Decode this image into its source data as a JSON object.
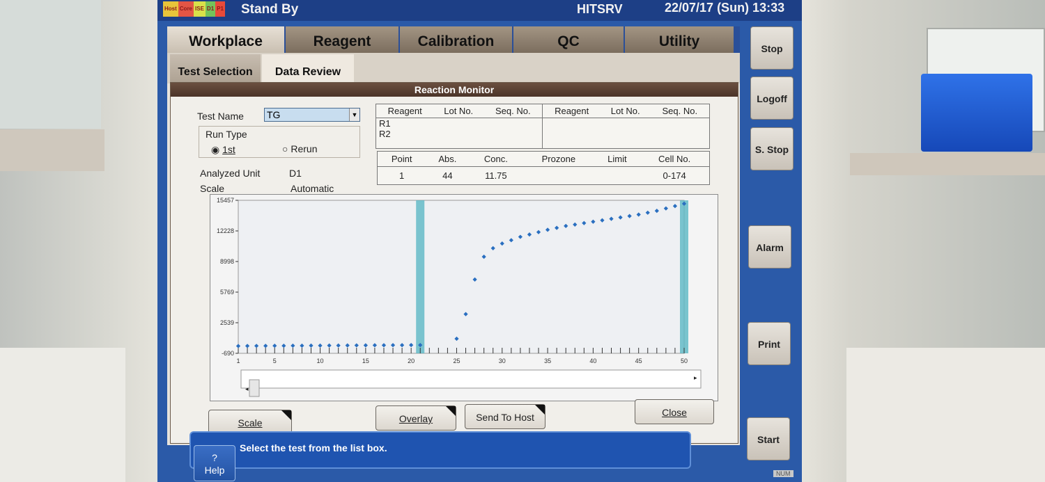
{
  "statusbar": {
    "blocks": [
      {
        "label": "Host",
        "color": "#e8c43a"
      },
      {
        "label": "Core",
        "color": "#e25545"
      },
      {
        "label": "ISE",
        "color": "#d9e04a"
      },
      {
        "label": "D1",
        "color": "#74c35a"
      },
      {
        "label": "P1",
        "color": "#e84a3a"
      }
    ],
    "status": "Stand By",
    "server": "HITSRV",
    "datetime": "22/07/17 (Sun) 13:33"
  },
  "side_buttons": {
    "stop": "Stop",
    "logoff": "Logoff",
    "s_stop": "S. Stop",
    "alarm": "Alarm",
    "print": "Print",
    "start": "Start"
  },
  "tabs": [
    "Workplace",
    "Reagent",
    "Calibration",
    "QC",
    "Utility"
  ],
  "subtabs": [
    "Test Selection",
    "Data Review"
  ],
  "dialog": {
    "title": "Reaction Monitor",
    "test_name_label": "Test Name",
    "test_name_value": "TG",
    "run_type_label": "Run Type",
    "run_type_options": [
      "1st",
      "Rerun"
    ],
    "run_type_selected": "1st",
    "analyzed_unit_label": "Analyzed Unit",
    "analyzed_unit_value": "D1",
    "scale_label": "Scale",
    "scale_value": "Automatic",
    "reagent_table": {
      "headers": [
        "Reagent",
        "Lot No.",
        "Seq. No.",
        "Reagent",
        "Lot No.",
        "Seq. No."
      ],
      "rows": [
        "R1",
        "R2"
      ]
    },
    "result_table": {
      "headers": [
        "Point",
        "Abs.",
        "Conc.",
        "Prozone",
        "Limit",
        "Cell No."
      ],
      "row": [
        "1",
        "44",
        "11.75",
        "",
        "",
        "0-174"
      ]
    },
    "buttons": {
      "scale": "Scale",
      "overlay": "Overlay",
      "send_to_host": "Send To Host",
      "close": "Close"
    }
  },
  "help": {
    "button_label_q": "?",
    "button_label": "Help",
    "message": "Select the test from the list box."
  },
  "num_indicator": "NUM",
  "chart_data": {
    "type": "scatter",
    "title": "",
    "xlabel": "",
    "ylabel": "",
    "x_ticks": [
      1,
      5,
      10,
      15,
      20,
      25,
      30,
      35,
      40,
      45,
      50
    ],
    "y_ticks": [
      -690,
      2539,
      5769,
      8998,
      12228,
      15457
    ],
    "xlim": [
      1,
      50
    ],
    "ylim": [
      -690,
      15457
    ],
    "highlight_bands_x": [
      21,
      50
    ],
    "series": [
      {
        "color": "#2a6fc0",
        "x": [
          1,
          2,
          3,
          4,
          5,
          6,
          7,
          8,
          9,
          10,
          11,
          12,
          13,
          14,
          15,
          16,
          17,
          18,
          19,
          20,
          21,
          25,
          26,
          27,
          28,
          29,
          30,
          31,
          32,
          33,
          34,
          35,
          36,
          37,
          38,
          39,
          40,
          41,
          42,
          43,
          44,
          45,
          46,
          47,
          48,
          49,
          50
        ],
        "y": [
          80,
          90,
          95,
          100,
          105,
          110,
          115,
          120,
          125,
          130,
          135,
          140,
          145,
          150,
          155,
          160,
          165,
          170,
          175,
          180,
          185,
          850,
          3450,
          7100,
          9500,
          10400,
          10900,
          11250,
          11600,
          11850,
          12100,
          12350,
          12550,
          12750,
          12900,
          13050,
          13200,
          13350,
          13500,
          13650,
          13800,
          13950,
          14150,
          14350,
          14600,
          14850,
          15100
        ]
      }
    ]
  }
}
